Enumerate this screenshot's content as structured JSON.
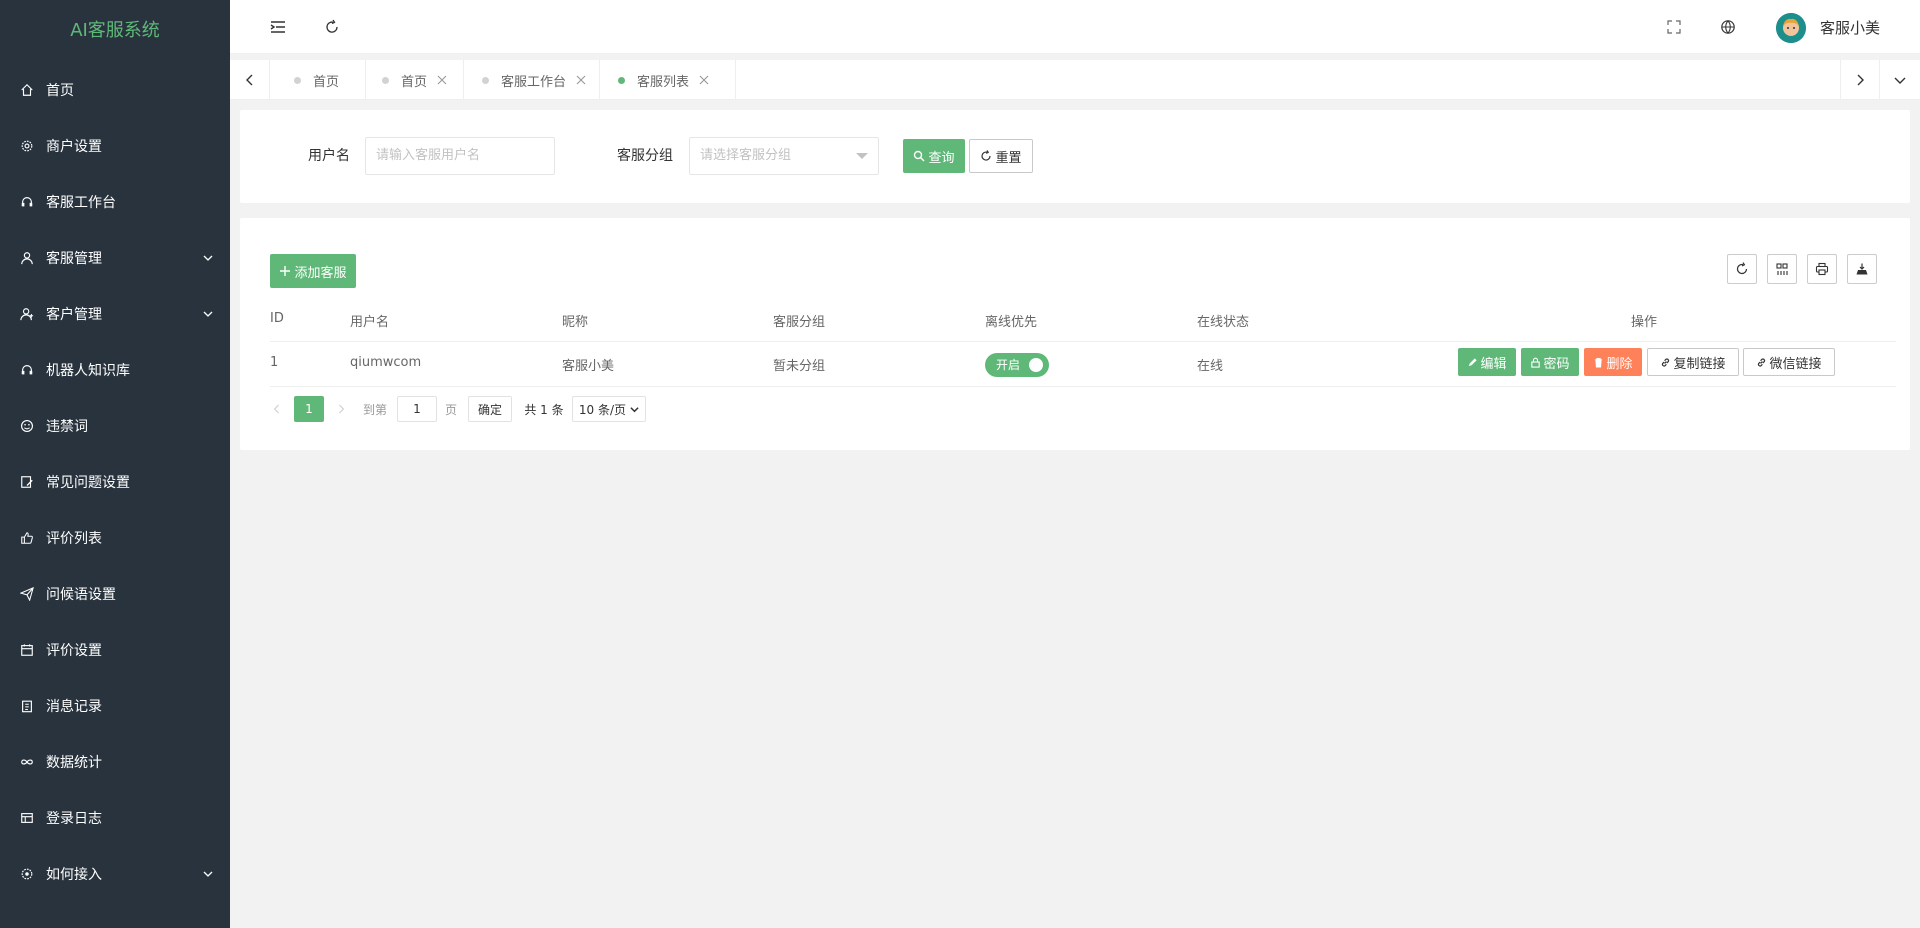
{
  "app": {
    "title": "AI客服系统"
  },
  "sidebar": {
    "items": [
      {
        "label": "首页",
        "icon": "home-icon"
      },
      {
        "label": "商户设置",
        "icon": "gear-icon"
      },
      {
        "label": "客服工作台",
        "icon": "headset-icon"
      },
      {
        "label": "客服管理",
        "icon": "user-icon",
        "expandable": true
      },
      {
        "label": "客户管理",
        "icon": "users-icon",
        "expandable": true
      },
      {
        "label": "机器人知识库",
        "icon": "headset-icon"
      },
      {
        "label": "违禁词",
        "icon": "smile-icon"
      },
      {
        "label": "常见问题设置",
        "icon": "edit-doc-icon"
      },
      {
        "label": "评价列表",
        "icon": "thumb-icon"
      },
      {
        "label": "问候语设置",
        "icon": "send-icon"
      },
      {
        "label": "评价设置",
        "icon": "calendar-icon"
      },
      {
        "label": "消息记录",
        "icon": "clipboard-icon"
      },
      {
        "label": "数据统计",
        "icon": "infinity-icon"
      },
      {
        "label": "登录日志",
        "icon": "table-icon"
      },
      {
        "label": "如何接入",
        "icon": "cog-icon",
        "expandable": true
      }
    ]
  },
  "header": {
    "username": "客服小美"
  },
  "tabs": [
    {
      "label": "首页",
      "closable": false,
      "active": false
    },
    {
      "label": "首页",
      "closable": true,
      "active": false
    },
    {
      "label": "客服工作台",
      "closable": true,
      "active": false
    },
    {
      "label": "客服列表",
      "closable": true,
      "active": true
    }
  ],
  "search": {
    "username_label": "用户名",
    "username_placeholder": "请输入客服用户名",
    "group_label": "客服分组",
    "group_placeholder": "请选择客服分组",
    "query_label": "查询",
    "reset_label": "重置"
  },
  "toolbar": {
    "add_label": "添加客服"
  },
  "table": {
    "columns": [
      "ID",
      "用户名",
      "昵称",
      "客服分组",
      "离线优先",
      "在线状态",
      "操作"
    ],
    "rows": [
      {
        "id": "1",
        "username": "qiumwcom",
        "nickname": "客服小美",
        "group": "暂未分组",
        "offline_first": "开启",
        "status": "在线"
      }
    ],
    "actions": {
      "edit": "编辑",
      "password": "密码",
      "delete": "删除",
      "copy_link": "复制链接",
      "wechat_link": "微信链接"
    }
  },
  "pagination": {
    "current": "1",
    "goto_prefix": "到第",
    "goto_value": "1",
    "goto_suffix": "页",
    "confirm": "确定",
    "total": "共 1 条",
    "page_size": "10 条/页"
  },
  "colors": {
    "sidebar_bg": "#28333e",
    "accent": "#5fb878",
    "danger": "#ff5722"
  }
}
